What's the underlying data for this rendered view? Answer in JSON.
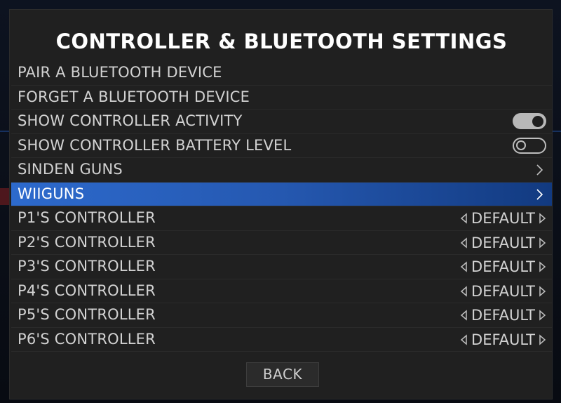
{
  "title": "CONTROLLER & BLUETOOTH SETTINGS",
  "menu": {
    "items": [
      {
        "label": "PAIR A BLUETOOTH DEVICE",
        "kind": "plain"
      },
      {
        "label": "FORGET A BLUETOOTH DEVICE",
        "kind": "plain"
      },
      {
        "label": "SHOW CONTROLLER ACTIVITY",
        "kind": "toggle",
        "state": "on"
      },
      {
        "label": "SHOW CONTROLLER BATTERY LEVEL",
        "kind": "toggle",
        "state": "off"
      },
      {
        "label": "SINDEN GUNS",
        "kind": "submenu",
        "icon": "chevron-right-icon"
      },
      {
        "label": "WIIGUNS",
        "kind": "submenu",
        "icon": "chevron-right-icon",
        "selected": true
      },
      {
        "label": "P1'S CONTROLLER",
        "kind": "selector",
        "value": "DEFAULT"
      },
      {
        "label": "P2'S CONTROLLER",
        "kind": "selector",
        "value": "DEFAULT"
      },
      {
        "label": "P3'S CONTROLLER",
        "kind": "selector",
        "value": "DEFAULT"
      },
      {
        "label": "P4'S CONTROLLER",
        "kind": "selector",
        "value": "DEFAULT"
      },
      {
        "label": "P5'S CONTROLLER",
        "kind": "selector",
        "value": "DEFAULT"
      },
      {
        "label": "P6'S CONTROLLER",
        "kind": "selector",
        "value": "DEFAULT"
      }
    ]
  },
  "footer": {
    "back_label": "BACK"
  },
  "colors": {
    "panel": "#202020",
    "selection": "#2558b0",
    "text": "#d2d2d2",
    "title": "#ffffff"
  }
}
